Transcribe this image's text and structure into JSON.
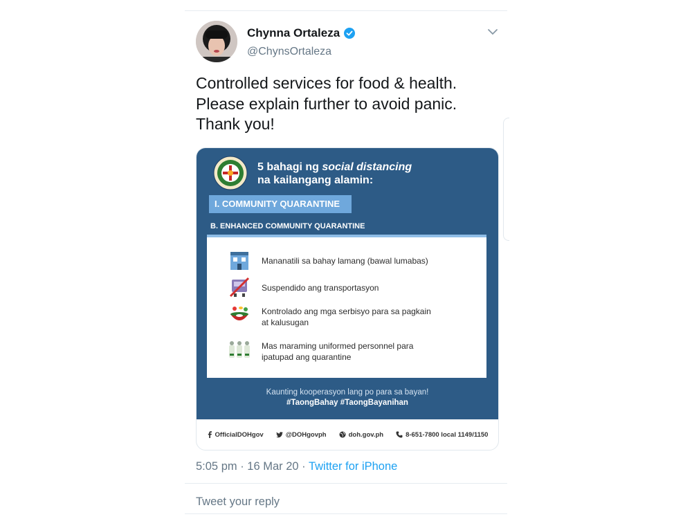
{
  "tweet": {
    "author_name": "Chynna Ortaleza",
    "author_handle": "@ChynsOrtaleza",
    "text": "Controlled services for food & health.\nPlease explain further to avoid panic.\nThank you!",
    "timestamp": "5:05 pm · 16 Mar 20 · ",
    "source": "Twitter for iPhone",
    "reply_placeholder": "Tweet your reply"
  },
  "poster": {
    "title_prefix": "5 bahagi ng ",
    "title_italic": "social distancing",
    "title_line2": "na kailangang alamin:",
    "section_label": "I. COMMUNITY QUARANTINE",
    "subsection_label": "B. ENHANCED COMMUNITY QUARANTINE",
    "items": [
      {
        "icon": "house-icon",
        "text": "Mananatili sa bahay lamang (bawal lumabas)"
      },
      {
        "icon": "no-transport-icon",
        "text": "Suspendido ang transportasyon"
      },
      {
        "icon": "food-bowl-icon",
        "text": "Kontrolado ang mga serbisyo para sa pagkain\nat kalusugan"
      },
      {
        "icon": "uniformed-personnel-icon",
        "text": "Mas maraming uniformed personnel para\nipatupad ang quarantine"
      }
    ],
    "footer_line1": "Kaunting kooperasyon lang po para sa bayan!",
    "footer_hashtags": "#TaongBahay #TaongBayanihan",
    "contacts": {
      "facebook": "OfficialDOHgov",
      "twitter": "@DOHgovph",
      "website": "doh.gov.ph",
      "phone": "8-651-7800 local 1149/1150"
    }
  },
  "colors": {
    "poster_bg": "#2d5b86",
    "section_box": "#6fa8dc",
    "link_blue": "#1da1f2",
    "verified_blue": "#1da1f2"
  }
}
